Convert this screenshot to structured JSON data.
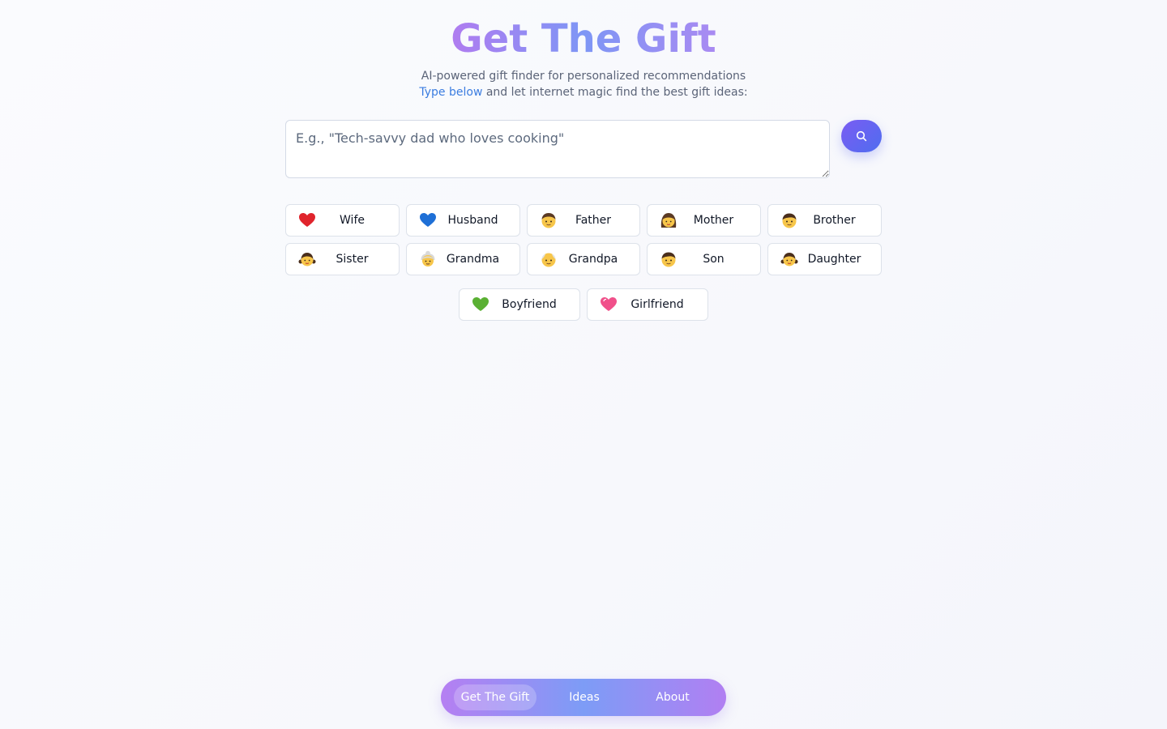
{
  "header": {
    "title": "Get The Gift",
    "subtitle_line1": "AI-powered gift finder for personalized recommendations",
    "subtitle_highlight": "Type below",
    "subtitle_rest": " and let internet magic find the best gift ideas:"
  },
  "search": {
    "placeholder": "E.g., \"Tech-savvy dad who loves cooking\"",
    "value": "",
    "button_icon": "search-icon"
  },
  "relations": [
    {
      "label": "Wife",
      "icon": "red-heart-icon"
    },
    {
      "label": "Husband",
      "icon": "blue-heart-icon"
    },
    {
      "label": "Father",
      "icon": "man-icon"
    },
    {
      "label": "Mother",
      "icon": "woman-icon"
    },
    {
      "label": "Brother",
      "icon": "boy-icon"
    },
    {
      "label": "Sister",
      "icon": "girl-icon"
    },
    {
      "label": "Grandma",
      "icon": "old-woman-icon"
    },
    {
      "label": "Grandpa",
      "icon": "old-man-icon"
    },
    {
      "label": "Son",
      "icon": "boy-icon"
    },
    {
      "label": "Daughter",
      "icon": "girl-icon"
    },
    {
      "label": "Boyfriend",
      "icon": "green-heart-icon"
    },
    {
      "label": "Girlfriend",
      "icon": "pink-heart-icon"
    }
  ],
  "nav": {
    "items": [
      {
        "label": "Get The Gift",
        "active": true
      },
      {
        "label": "Ideas",
        "active": false
      },
      {
        "label": "About",
        "active": false
      }
    ]
  },
  "colors": {
    "accent": "#4f6df0",
    "link": "#3b7de0",
    "title_gradient": [
      "#b07cf0",
      "#7e96f5",
      "#a98af2"
    ],
    "nav_gradient": [
      "#b57ff2",
      "#7d9cf6",
      "#b17ff2"
    ]
  }
}
